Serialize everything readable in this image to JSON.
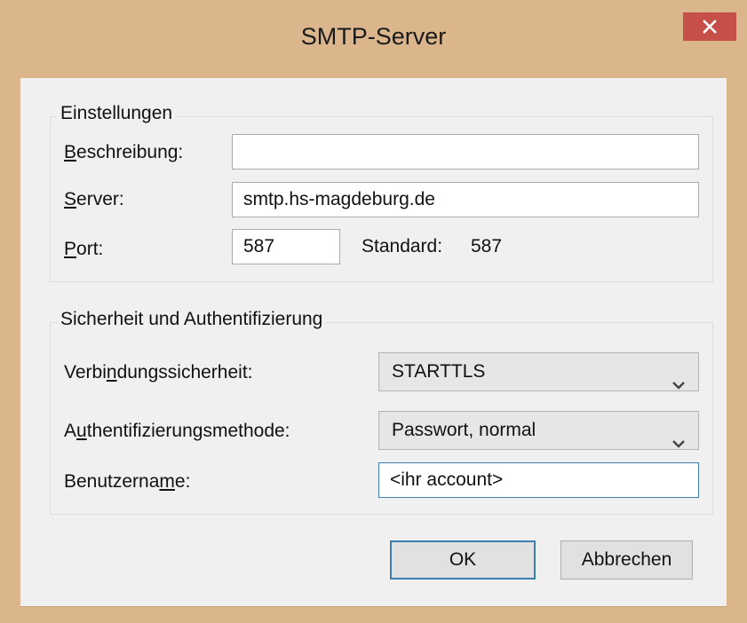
{
  "window": {
    "title": "SMTP-Server"
  },
  "settings_group": {
    "legend": "Einstellungen",
    "description": {
      "label_accel": "B",
      "label_rest": "eschreibung:",
      "value": ""
    },
    "server": {
      "label_accel": "S",
      "label_rest": "erver:",
      "value": "smtp.hs-magdeburg.de"
    },
    "port": {
      "label_accel": "P",
      "label_rest": "ort:",
      "value": "587",
      "default_label": "Standard:",
      "default_value": "587"
    }
  },
  "security_group": {
    "legend": "Sicherheit und Authentifizierung",
    "connection_security": {
      "label_pre": "Verbi",
      "label_accel": "n",
      "label_post": "dungssicherheit:",
      "selected": "STARTTLS"
    },
    "auth_method": {
      "label_pre": "A",
      "label_accel": "u",
      "label_post": "thentifizierungsmethode:",
      "selected": "Passwort, normal"
    },
    "username": {
      "label_pre": "Benutzerna",
      "label_accel": "m",
      "label_post": "e:",
      "value": "<ihr account>"
    }
  },
  "buttons": {
    "ok": "OK",
    "cancel": "Abbrechen"
  },
  "icons": {
    "close": "close-icon",
    "dropdown": "chevron-down-icon"
  },
  "colors": {
    "frame": "#dbb68d",
    "close_button": "#c74f4a",
    "focus_border": "#3c7fb1"
  }
}
